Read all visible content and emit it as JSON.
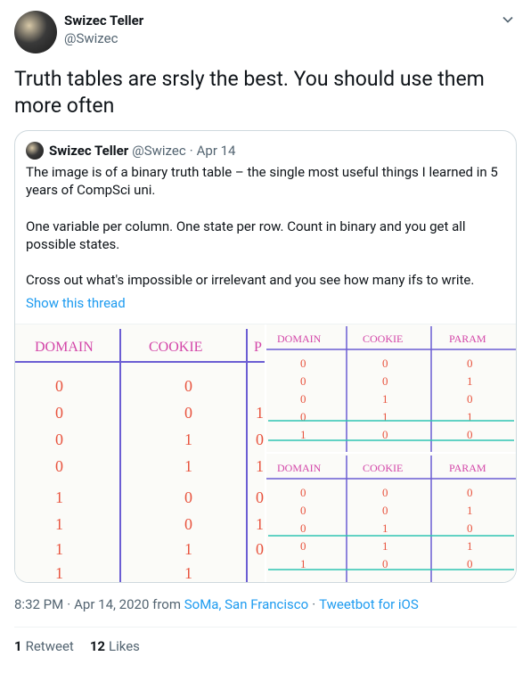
{
  "author": {
    "display_name": "Swizec Teller",
    "handle": "@Swizec"
  },
  "tweet_text": "Truth tables are srsly the best. You should use them more often",
  "quoted": {
    "author_name": "Swizec Teller",
    "author_handle": "@Swizec",
    "date": "Apr 14",
    "text": "The image is of a binary truth table – the single most useful things I learned in 5 years of CompSci uni.\n\nOne variable per column. One state per row. Count in binary and you get all possible states.\n\nCross out what's impossible or irrelevant and you see how many ifs to write.",
    "show_thread": "Show this thread",
    "table_headers": [
      "DOMAIN",
      "COOKIE",
      "PARAM"
    ]
  },
  "meta": {
    "time": "8:32 PM",
    "date": "Apr 14, 2020",
    "from_label": "from",
    "location": "SoMa, San Francisco",
    "source": "Tweetbot for iOS"
  },
  "stats": {
    "retweets_count": "1",
    "retweets_label": "Retweet",
    "likes_count": "12",
    "likes_label": "Likes"
  }
}
